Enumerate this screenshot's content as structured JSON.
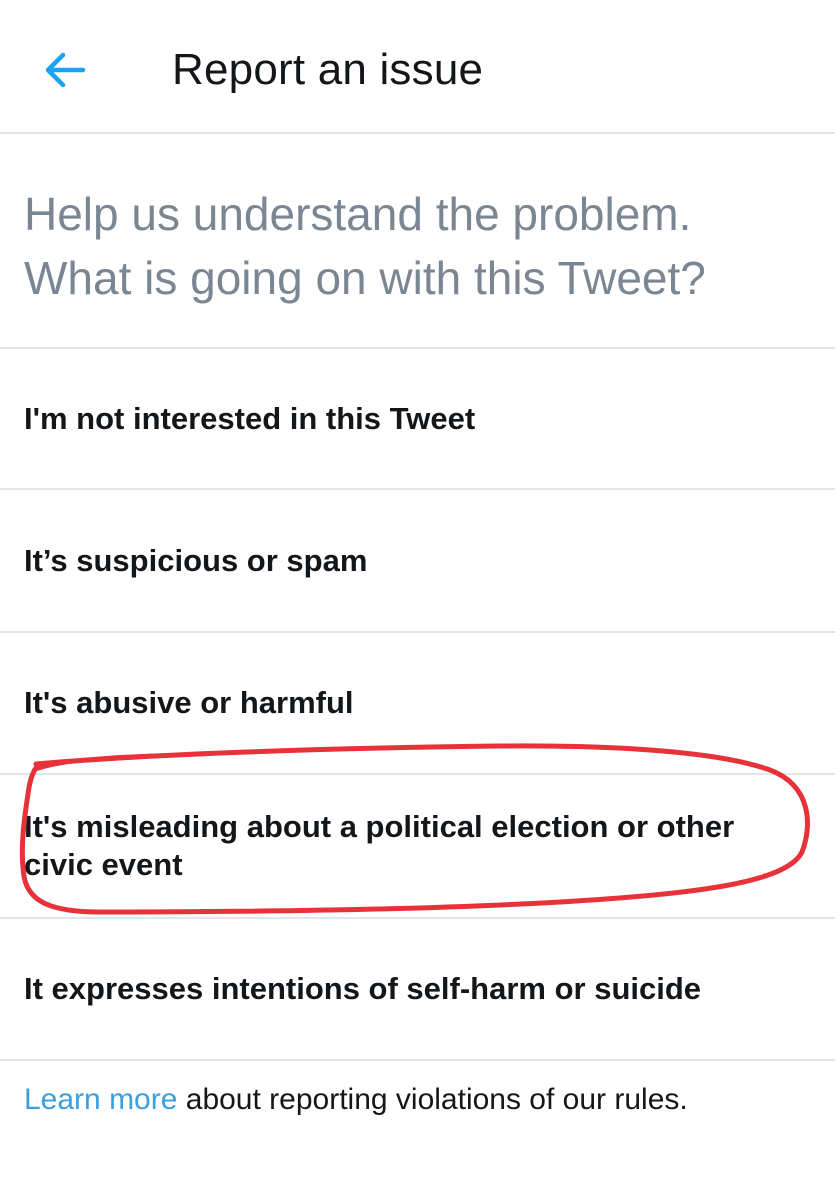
{
  "header": {
    "back_icon": "arrow-left-icon",
    "title": "Report an issue",
    "accent_color": "#1da1f2"
  },
  "prompt": {
    "line1": "Help us understand the problem.",
    "line2": "What is going on with this Tweet?"
  },
  "options": [
    {
      "label": "I'm not interested in this Tweet"
    },
    {
      "label": "It’s suspicious or spam"
    },
    {
      "label": "It's abusive or harmful"
    },
    {
      "label": "It's misleading about a political election or other civic event",
      "highlighted": true,
      "highlight_color": "#e8323a"
    },
    {
      "label": "It expresses intentions of self-harm or suicide"
    }
  ],
  "footer": {
    "link_text": "Learn more",
    "text": " about reporting violations of our rules."
  }
}
